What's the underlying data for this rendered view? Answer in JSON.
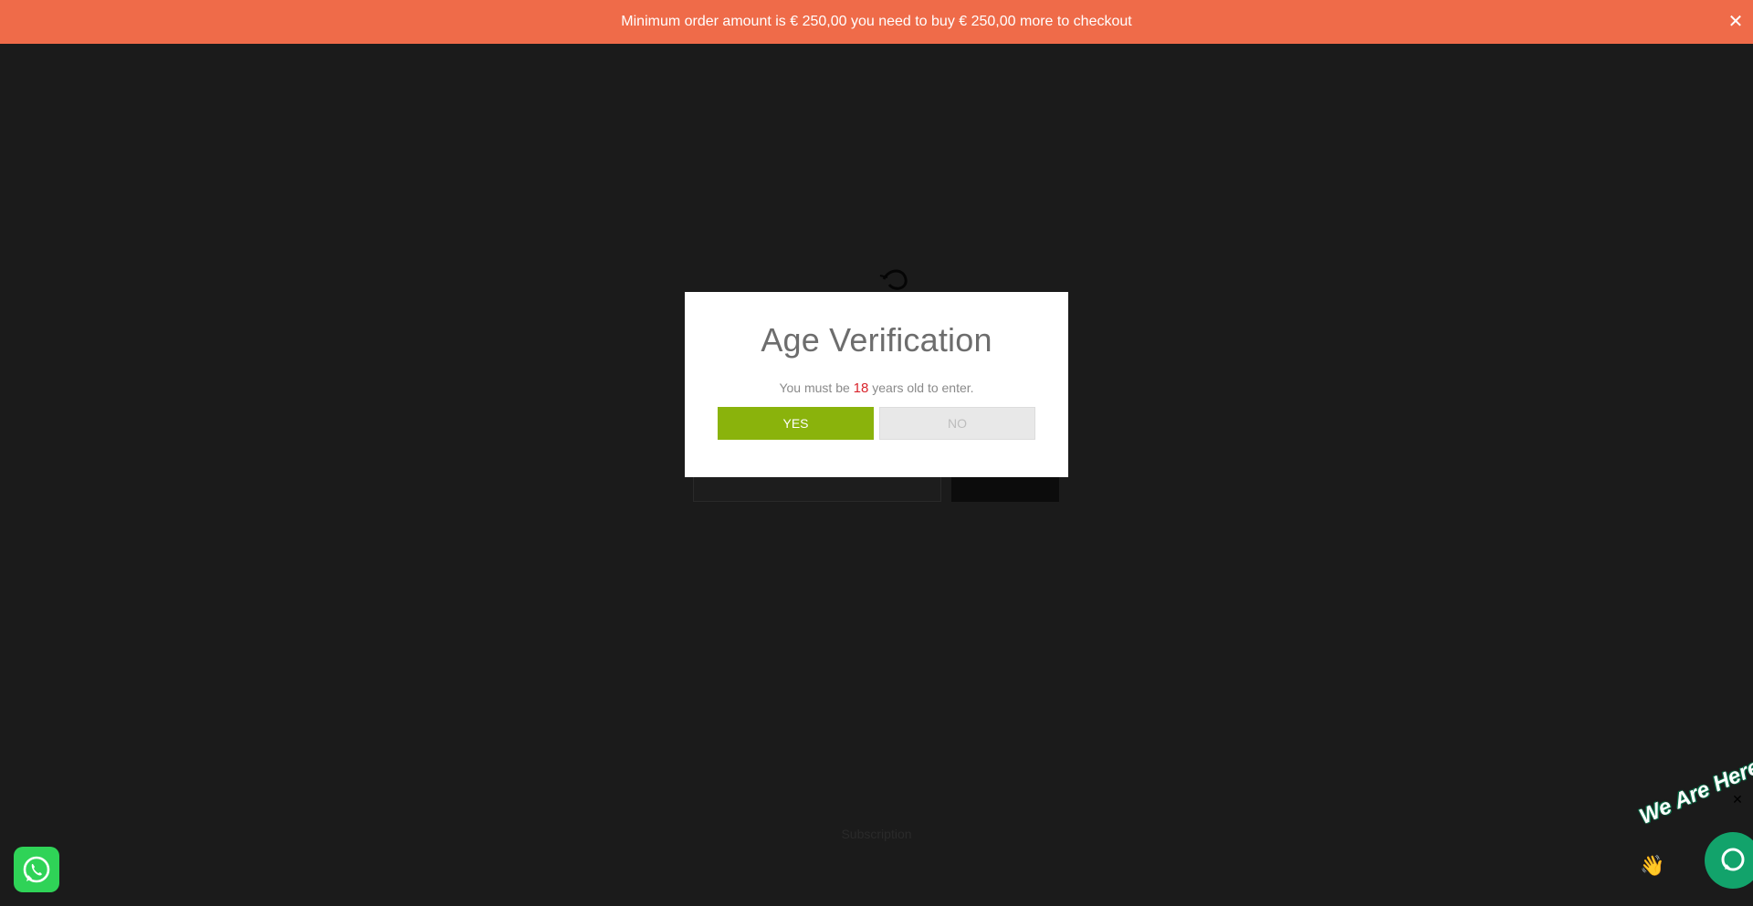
{
  "notice_bar": {
    "message": "Minimum order amount is € 250,00 you need to buy € 250,00 more to checkout",
    "close_glyph": "✕",
    "background_color": "#ef6b49"
  },
  "age_modal": {
    "title": "Age Verification",
    "text_before": "You must be ",
    "age": "18",
    "text_after": " years old to enter.",
    "yes_label": "YES",
    "no_label": "NO",
    "yes_color": "#8ab30c",
    "age_color": "#d9242c"
  },
  "background_page": {
    "footer_link": "Subscription"
  },
  "chat_widget": {
    "banner_text": "We Are Here!",
    "dismiss_glyph": "✕",
    "icon": "chat-bubble-icon",
    "color": "#12a36b"
  },
  "whatsapp": {
    "icon": "whatsapp-icon",
    "color": "#2fd357"
  }
}
